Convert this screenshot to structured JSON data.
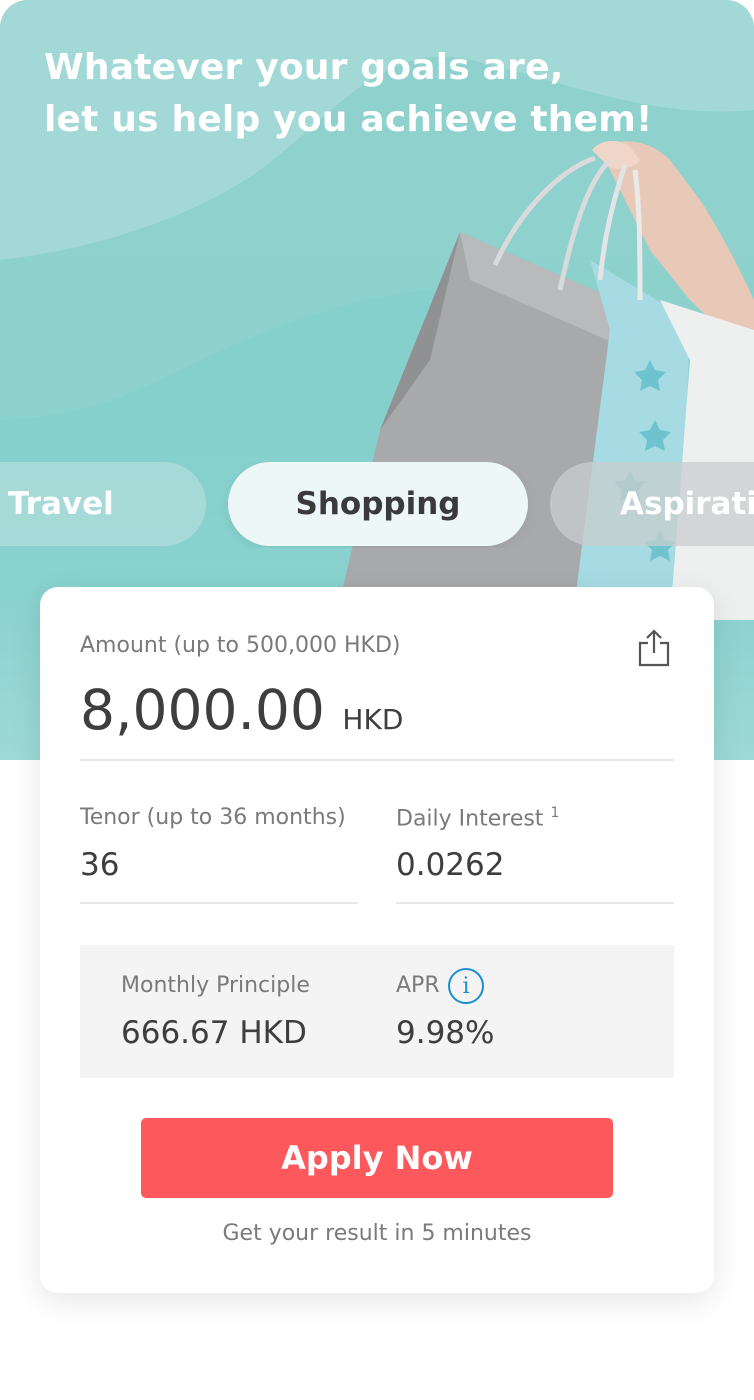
{
  "hero": {
    "headline_line1": "Whatever your goals are,",
    "headline_line2": "let us help you achieve them!"
  },
  "tabs": [
    {
      "label": "Travel",
      "active": false
    },
    {
      "label": "Shopping",
      "active": true
    },
    {
      "label": "Aspiratio",
      "active": false
    }
  ],
  "calculator": {
    "amount_label": "Amount (up to 500,000 HKD)",
    "amount_value": "8,000.00",
    "amount_currency": "HKD",
    "tenor_label": "Tenor (up to 36 months)",
    "tenor_value": "36",
    "daily_interest_label": "Daily Interest",
    "daily_interest_sup": "1",
    "daily_interest_value": "0.0262",
    "monthly_principle_label": "Monthly Principle",
    "monthly_principle_value": "666.67 HKD",
    "apr_label": "APR",
    "apr_value": "9.98%",
    "apply_label": "Apply Now",
    "footnote": "Get your result in 5 minutes"
  },
  "icons": {
    "share": "share-icon",
    "info": "info-icon"
  },
  "colors": {
    "accent_teal": "#86cfcc",
    "apply_button": "#fd585c",
    "info_blue": "#1a8fd0"
  }
}
